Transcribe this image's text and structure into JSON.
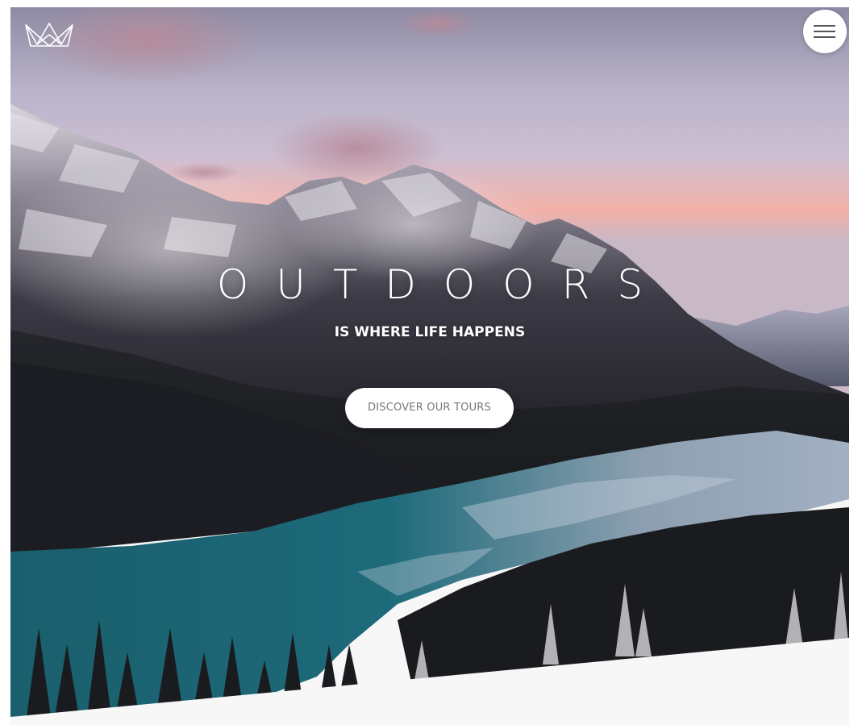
{
  "header": {
    "logo": {
      "icon": "crown-logo-icon"
    },
    "menu": {
      "icon": "hamburger-menu-icon"
    }
  },
  "hero": {
    "title": "OUTDOORS",
    "subtitle": "IS WHERE LIFE HAPPENS",
    "cta_label": "DISCOVER OUR TOURS",
    "background": "mountain-lake-landscape",
    "section_below_color": "#f7f7f7"
  },
  "colors": {
    "cta_text": "#777777",
    "overlay_text": "#ffffff",
    "lake": "#1d6a7a"
  }
}
